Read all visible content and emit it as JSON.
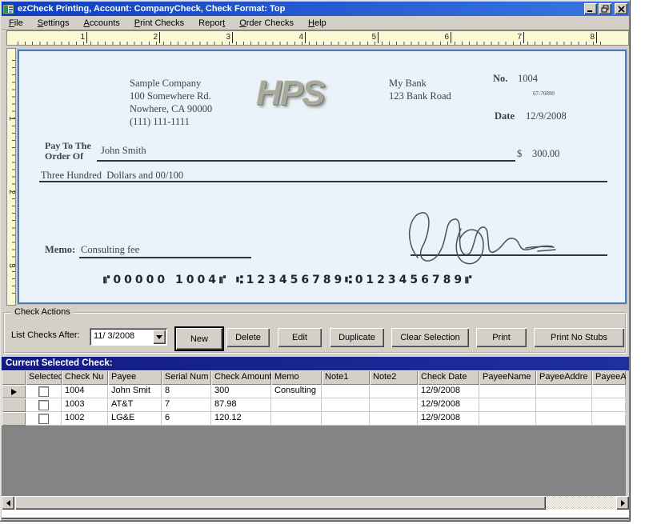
{
  "window": {
    "title": "ezCheck Printing, Account: CompanyCheck, Check Format: Top",
    "control_icons": [
      "minimize-icon",
      "restore-icon",
      "close-icon"
    ]
  },
  "menu": {
    "items": [
      {
        "label": "File"
      },
      {
        "label": "Settings"
      },
      {
        "label": "Accounts"
      },
      {
        "label": "Print Checks"
      },
      {
        "label": "Report"
      },
      {
        "label": "Order Checks"
      },
      {
        "label": "Help"
      }
    ]
  },
  "ruler": {
    "h": [
      "1",
      "2",
      "3",
      "4",
      "5",
      "6",
      "7",
      "8"
    ],
    "v": [
      "1",
      "2",
      "3"
    ]
  },
  "check": {
    "company": {
      "name": "Sample Company",
      "address1": "100 Somewhere Rd.",
      "address2": "Nowhere, CA 90000",
      "phone": "(111) 111-1111"
    },
    "logo_text": "HPS",
    "bank": {
      "name": "My Bank",
      "address": "123 Bank Road"
    },
    "number_label": "No.",
    "number": "1004",
    "fraction": "67-76890",
    "date_label": "Date",
    "date": "12/9/2008",
    "payto_label_line1": "Pay To The",
    "payto_label_line2": "Order Of",
    "payee": "John Smith",
    "dollar_sign": "$",
    "amount": "300.00",
    "amount_words": "Three Hundred  Dollars and 00/100",
    "memo_label": "Memo:",
    "memo": "Consulting fee",
    "micr": "⑈00000 1004⑈ ⑆123456789⑆0123456789⑈"
  },
  "check_actions": {
    "group_label": "Check Actions",
    "list_after_label": "List Checks After:",
    "date_value": "11/ 3/2008",
    "buttons": [
      {
        "label": "New"
      },
      {
        "label": "Delete"
      },
      {
        "label": "Edit"
      },
      {
        "label": "Duplicate"
      },
      {
        "label": "Clear Selection"
      },
      {
        "label": "Print"
      },
      {
        "label": "Print No Stubs"
      }
    ]
  },
  "grid": {
    "section_title": "Current Selected Check:",
    "columns": [
      "",
      "Selected",
      "Check Nu",
      "Payee",
      "Serial Num",
      "Check Amount",
      "Memo",
      "Note1",
      "Note2",
      "Check Date",
      "PayeeName",
      "PayeeAddre",
      "PayeeAc"
    ],
    "rows": [
      {
        "current": true,
        "checked": false,
        "cells": [
          "1004",
          "John Smit",
          "8",
          "300",
          "Consulting",
          "",
          "",
          "12/9/2008",
          "",
          "",
          ""
        ]
      },
      {
        "current": false,
        "checked": false,
        "cells": [
          "1003",
          "AT&T",
          "7",
          "87.98",
          "",
          "",
          "",
          "12/9/2008",
          "",
          "",
          ""
        ]
      },
      {
        "current": false,
        "checked": false,
        "cells": [
          "1002",
          "LG&E",
          "6",
          "120.12",
          "",
          "",
          "",
          "12/9/2008",
          "",
          "",
          ""
        ]
      }
    ]
  }
}
